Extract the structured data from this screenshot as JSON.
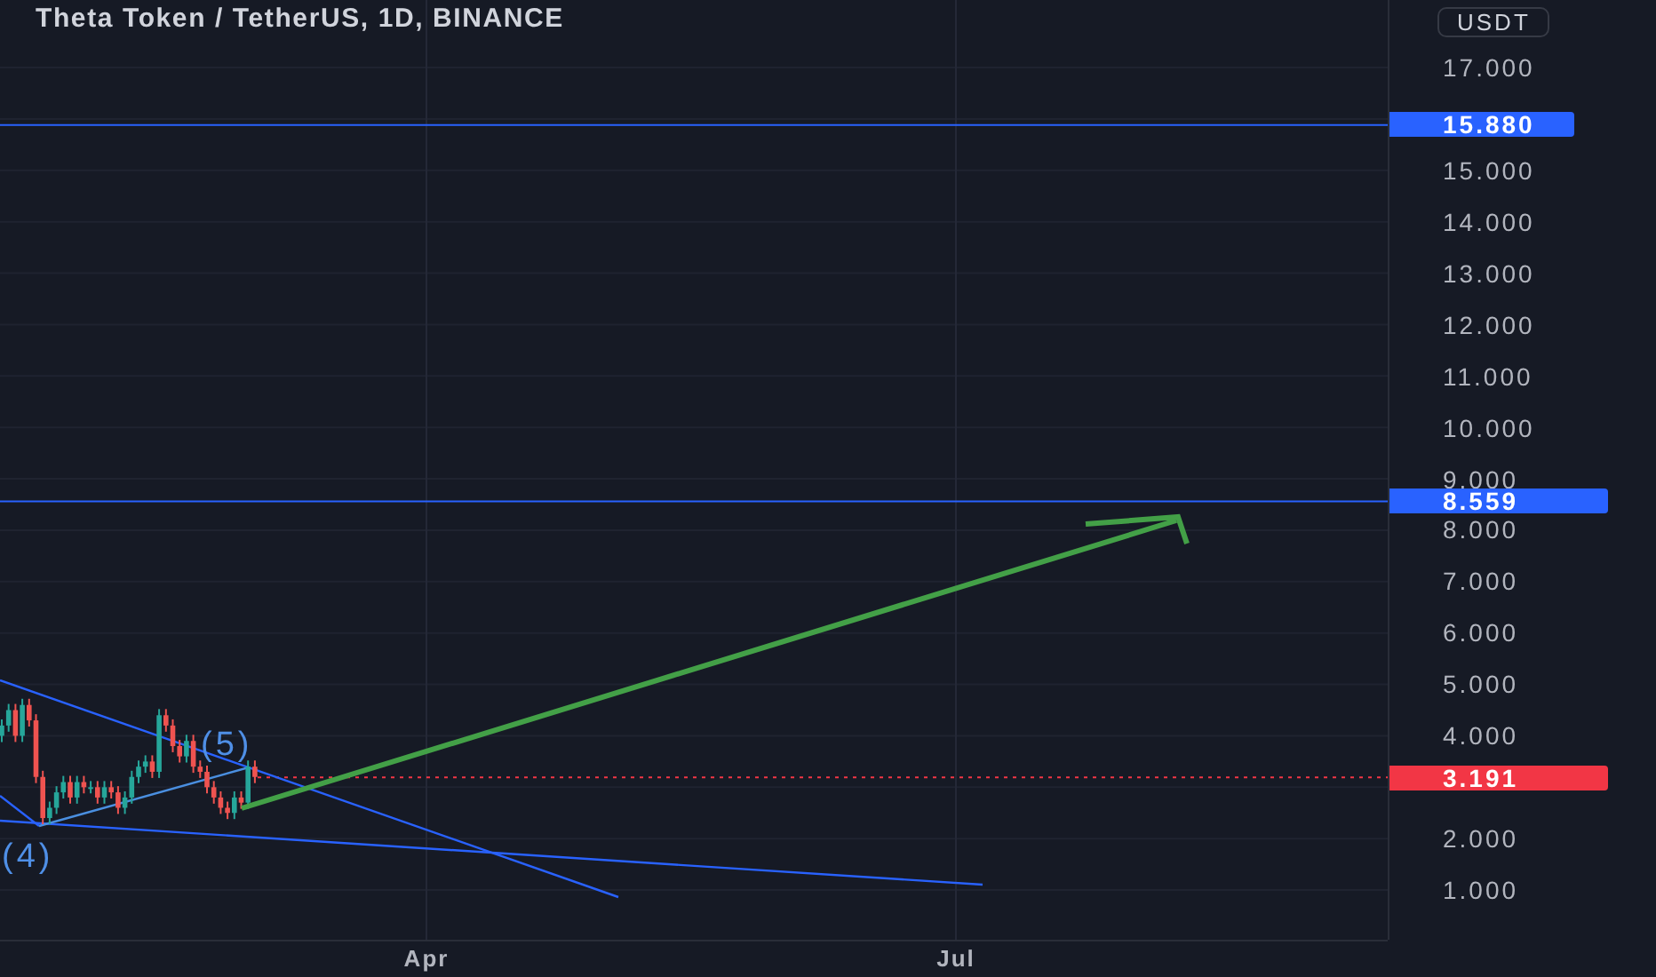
{
  "chart": {
    "title": "Theta Token / TetherUS, 1D, BINANCE",
    "wave_labels": [
      "(5)",
      "(4)"
    ]
  },
  "price_axis": {
    "currency": "USDT",
    "ticks": [
      "17.000",
      "15.000",
      "14.000",
      "13.000",
      "12.000",
      "11.000",
      "10.000",
      "9.000",
      "8.000",
      "7.000",
      "6.000",
      "5.000",
      "4.000",
      "2.000",
      "1.000"
    ],
    "price_labels": [
      {
        "text": "15.880",
        "color": "#2962ff"
      },
      {
        "text": "8.559",
        "color": "#2962ff"
      },
      {
        "text": "3.191",
        "color": "#f23645"
      }
    ]
  },
  "time_axis": {
    "labels": [
      "Apr",
      "Jul"
    ]
  }
}
